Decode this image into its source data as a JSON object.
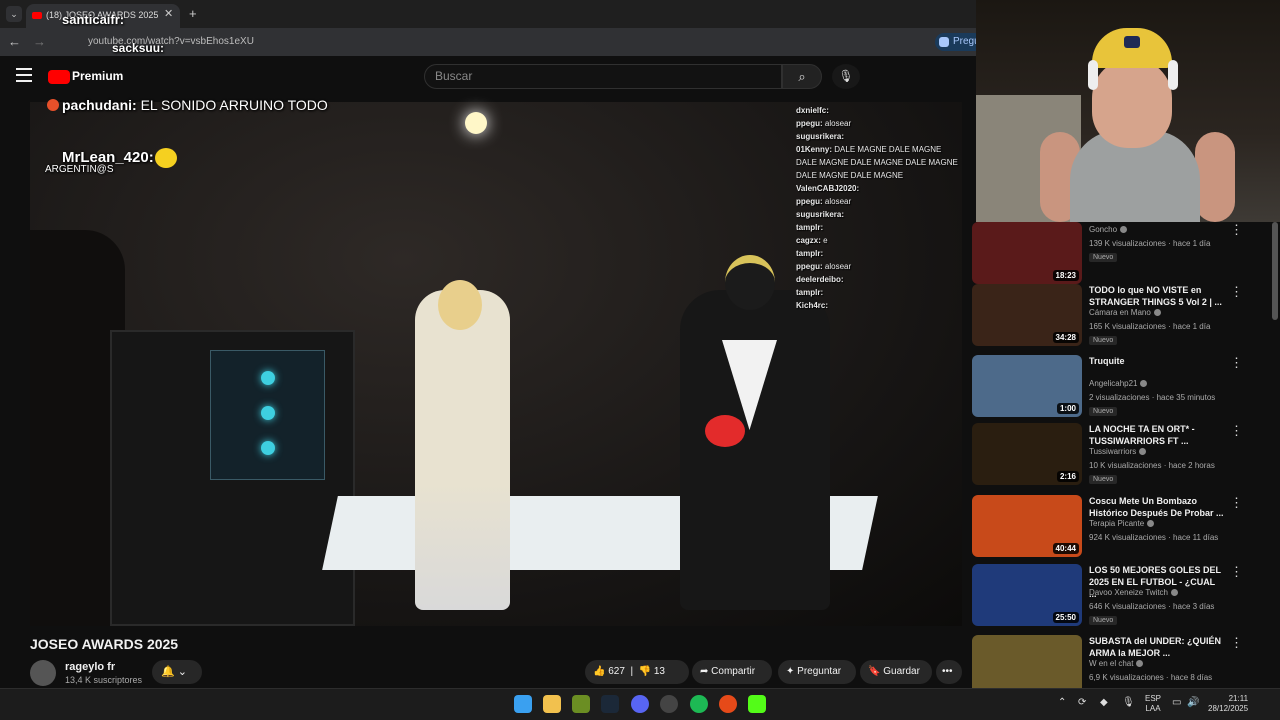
{
  "browser": {
    "tab_title": "(18) JOSEO AWARDS 2025",
    "tab_close": "✕",
    "new_tab": "+",
    "tab_list": "⌄",
    "url": "youtube.com/watch?v=vsbEhos1eXU",
    "ask_label": "Pregu"
  },
  "youtube": {
    "logo_text": "Premium",
    "search_placeholder": "Buscar",
    "search_icon": "search-icon",
    "mic_icon": "mic-icon"
  },
  "overlays": {
    "top_user": "santicaifr:",
    "second_user": "sacksuu:",
    "message_user": "pachudani:",
    "message_text": "EL SONIDO ARRUINO TODO",
    "highlight_user": "MrLean_420:",
    "highlight_badge": "ARGENTIN@S"
  },
  "chat": [
    {
      "user": "dxnielfc:",
      "text": ""
    },
    {
      "user": "ppegu:",
      "text": "alosear"
    },
    {
      "user": "sugusrikera:",
      "text": ""
    },
    {
      "user": "01Kenny:",
      "text": "DALE MAGNE DALE MAGNE DALE MAGNE DALE MAGNE DALE MAGNE DALE MAGNE DALE MAGNE"
    },
    {
      "user": "ValenCABJ2020:",
      "text": ""
    },
    {
      "user": "ppegu:",
      "text": "alosear"
    },
    {
      "user": "sugusrikera:",
      "text": ""
    },
    {
      "user": "tamplr:",
      "text": ""
    },
    {
      "user": "cagzx:",
      "text": "e"
    },
    {
      "user": "tamplr:",
      "text": ""
    },
    {
      "user": "ppegu:",
      "text": "alosear"
    },
    {
      "user": "deelerdeibo:",
      "text": ""
    },
    {
      "user": "tamplr:",
      "text": ""
    },
    {
      "user": "Kich4rc:",
      "text": ""
    }
  ],
  "video": {
    "title": "JOSEO AWARDS 2025",
    "channel_name": "rageylo fr",
    "subscribers": "13,4 K suscriptores",
    "likes": "627",
    "dislikes": "13",
    "share_label": "Compartir",
    "ask_label": "Preguntar",
    "save_label": "Guardar"
  },
  "recommendations": [
    {
      "title": "",
      "channel": "Goncho",
      "meta": "139 K visualizaciones · hace 1 día",
      "badge": "Nuevo",
      "duration": "18:23",
      "thumb_color": "#5a1a1a"
    },
    {
      "title": "TODO lo que NO VISTE en STRANGER THINGS 5  Vol 2 | ...",
      "channel": "Cámara en Mano",
      "meta": "165 K visualizaciones · hace 1 día",
      "badge": "Nuevo",
      "duration": "34:28",
      "thumb_color": "#3a2418"
    },
    {
      "title": "Truquite",
      "channel": "Angelicahp21",
      "meta": "2 visualizaciones · hace 35 minutos",
      "badge": "Nuevo",
      "duration": "1:00",
      "thumb_color": "#4d6a8a"
    },
    {
      "title": "LA NOCHE TA EN ORT* - TUSSIWARRIORS FT ...",
      "channel": "Tussiwarriors",
      "meta": "10 K visualizaciones · hace 2 horas",
      "badge": "Nuevo",
      "duration": "2:16",
      "thumb_color": "#2a1e10"
    },
    {
      "title": "Coscu Mete Un Bombazo Histórico Después De Probar ...",
      "channel": "Terapia Picante",
      "meta": "924 K visualizaciones · hace 11 días",
      "badge": "",
      "duration": "40:44",
      "thumb_color": "#c84a1a"
    },
    {
      "title": "LOS 50 MEJORES GOLES DEL 2025 EN EL FUTBOL - ¿CUAL ...",
      "channel": "Davoo Xeneize Twitch",
      "meta": "646 K visualizaciones · hace 3 días",
      "badge": "Nuevo",
      "duration": "25:50",
      "thumb_color": "#1f3a7a"
    },
    {
      "title": "SUBASTA del UNDER: ¿QUIÉN ARMA la MEJOR ...",
      "channel": "W en el chat",
      "meta": "6,9 K visualizaciones · hace 8 días",
      "badge": "",
      "duration": "",
      "thumb_color": "#6a5a2a"
    }
  ],
  "taskbar": {
    "lang_top": "ESP",
    "lang_bottom": "LAA",
    "time": "21:11",
    "date": "28/12/2025"
  },
  "colors": {
    "accent": "#ff0000",
    "bg": "#0f0f0f",
    "chip": "#272727"
  }
}
